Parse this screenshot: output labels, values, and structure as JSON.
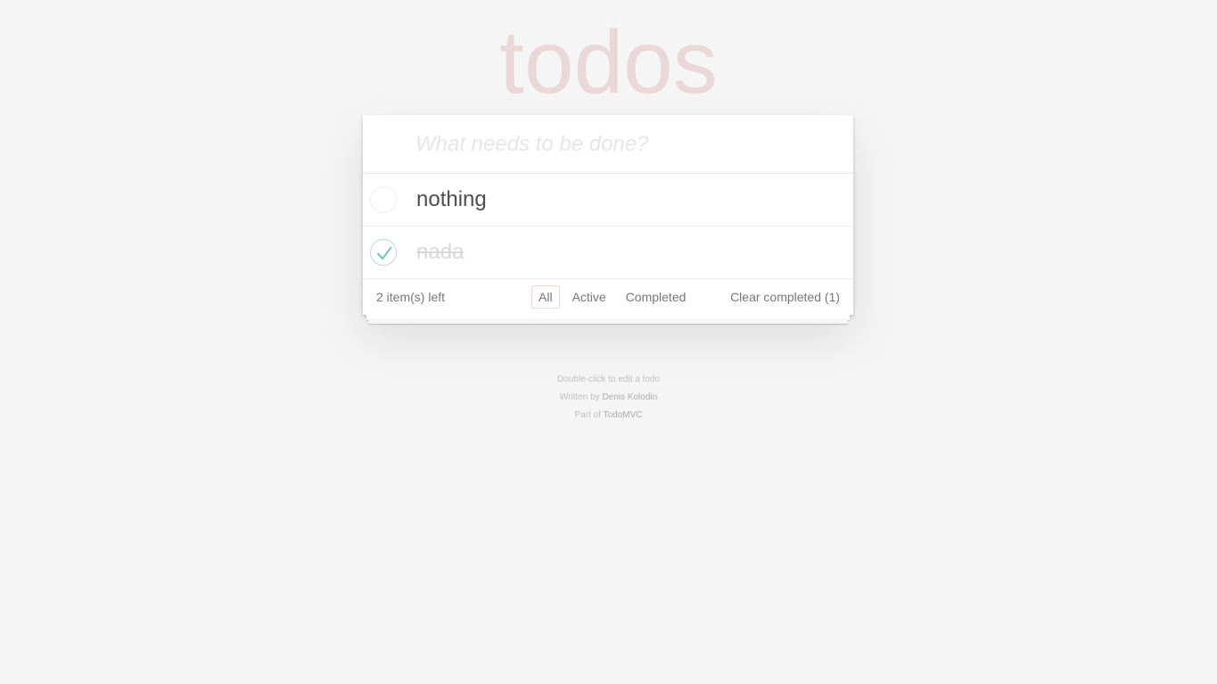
{
  "header": {
    "title": "todos"
  },
  "new_todo": {
    "placeholder": "What needs to be done?",
    "value": ""
  },
  "todos": [
    {
      "label": "nothing",
      "completed": false
    },
    {
      "label": "nada",
      "completed": true
    }
  ],
  "footer": {
    "count_label": "2 item(s) left",
    "filters": [
      {
        "label": "All",
        "selected": true
      },
      {
        "label": "Active",
        "selected": false
      },
      {
        "label": "Completed",
        "selected": false
      }
    ],
    "clear_completed_label": "Clear completed (1)"
  },
  "info": {
    "hint": "Double-click to edit a todo",
    "written_by_prefix": "Written by",
    "author": "Denis Kolodin",
    "part_of_prefix": "Part of",
    "project": "TodoMVC"
  },
  "colors": {
    "accent_check": "#5dc2af",
    "title": "rgba(175,47,47,0.15)",
    "selected_filter_border": "rgba(175,47,47,0.2)"
  }
}
